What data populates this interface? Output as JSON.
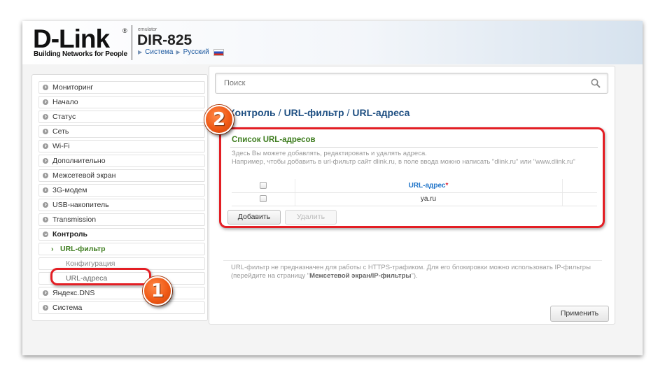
{
  "header": {
    "logo_word": "D-Link",
    "logo_reg": "®",
    "logo_tagline": "Building Networks for People",
    "emulator_label": "emulator",
    "model": "DIR-825",
    "system_link": "Система",
    "language_link": "Русский"
  },
  "sidebar": {
    "items": [
      {
        "label": "Мониторинг"
      },
      {
        "label": "Начало"
      },
      {
        "label": "Статус"
      },
      {
        "label": "Сеть"
      },
      {
        "label": "Wi-Fi"
      },
      {
        "label": "Дополнительно"
      },
      {
        "label": "Межсетевой экран"
      },
      {
        "label": "3G-модем"
      },
      {
        "label": "USB-накопитель"
      },
      {
        "label": "Transmission"
      },
      {
        "label": "Контроль"
      },
      {
        "label": "URL-фильтр"
      },
      {
        "label": "Конфигурация"
      },
      {
        "label": "URL-адреса"
      },
      {
        "label": "Яндекс.DNS"
      },
      {
        "label": "Система"
      }
    ]
  },
  "search": {
    "placeholder": "Поиск"
  },
  "breadcrumb": {
    "part1": "Контроль",
    "part2": "URL-фильтр",
    "part3": "URL-адреса",
    "separator": "/"
  },
  "url_list": {
    "title": "Список URL-адресов",
    "description_line1": "Здесь Вы можете добавлять, редактировать и удалять адреса.",
    "description_line2": "Например, чтобы добавить в url-фильтр сайт dlink.ru, в поле ввода можно написать \"dlink.ru\" или \"www.dlink.ru\"",
    "column_header": "URL-адрес",
    "required_mark": "*",
    "rows": [
      "ya.ru"
    ],
    "add_button": "Добавить",
    "delete_button": "Удалить"
  },
  "note": {
    "text_before": "URL-фильтр не предназначен для работы с HTTPS-трафиком. Для его блокировки можно использовать IP-фильтры (перейдите на страницу \"",
    "link_text": "Межсетевой экран/IP-фильтры",
    "text_after": "\")."
  },
  "apply_button": "Применить",
  "annotations": {
    "badge1": "1",
    "badge2": "2"
  },
  "colors": {
    "annotation_red": "#e31e24",
    "badge_orange": "#f05a16",
    "accent_green": "#3e7d1f",
    "accent_blue": "#1e4f82"
  }
}
